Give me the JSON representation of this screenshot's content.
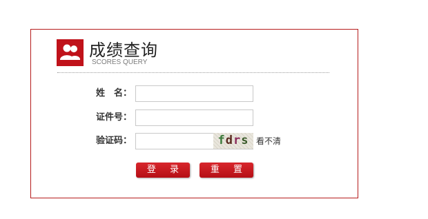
{
  "header": {
    "title": "成绩查询",
    "subtitle": "SCORES QUERY",
    "icon": "users-icon",
    "accent_color": "#c0121a"
  },
  "form": {
    "name_label": "姓　名：",
    "name_value": "",
    "id_label": "证件号：",
    "id_value": "",
    "captcha_label": "验证码：",
    "captcha_value": "",
    "captcha_chars": [
      "f",
      "d",
      "r",
      "s"
    ],
    "captcha_refresh": "看不清"
  },
  "buttons": {
    "login": "登 录",
    "reset": "重 置"
  }
}
